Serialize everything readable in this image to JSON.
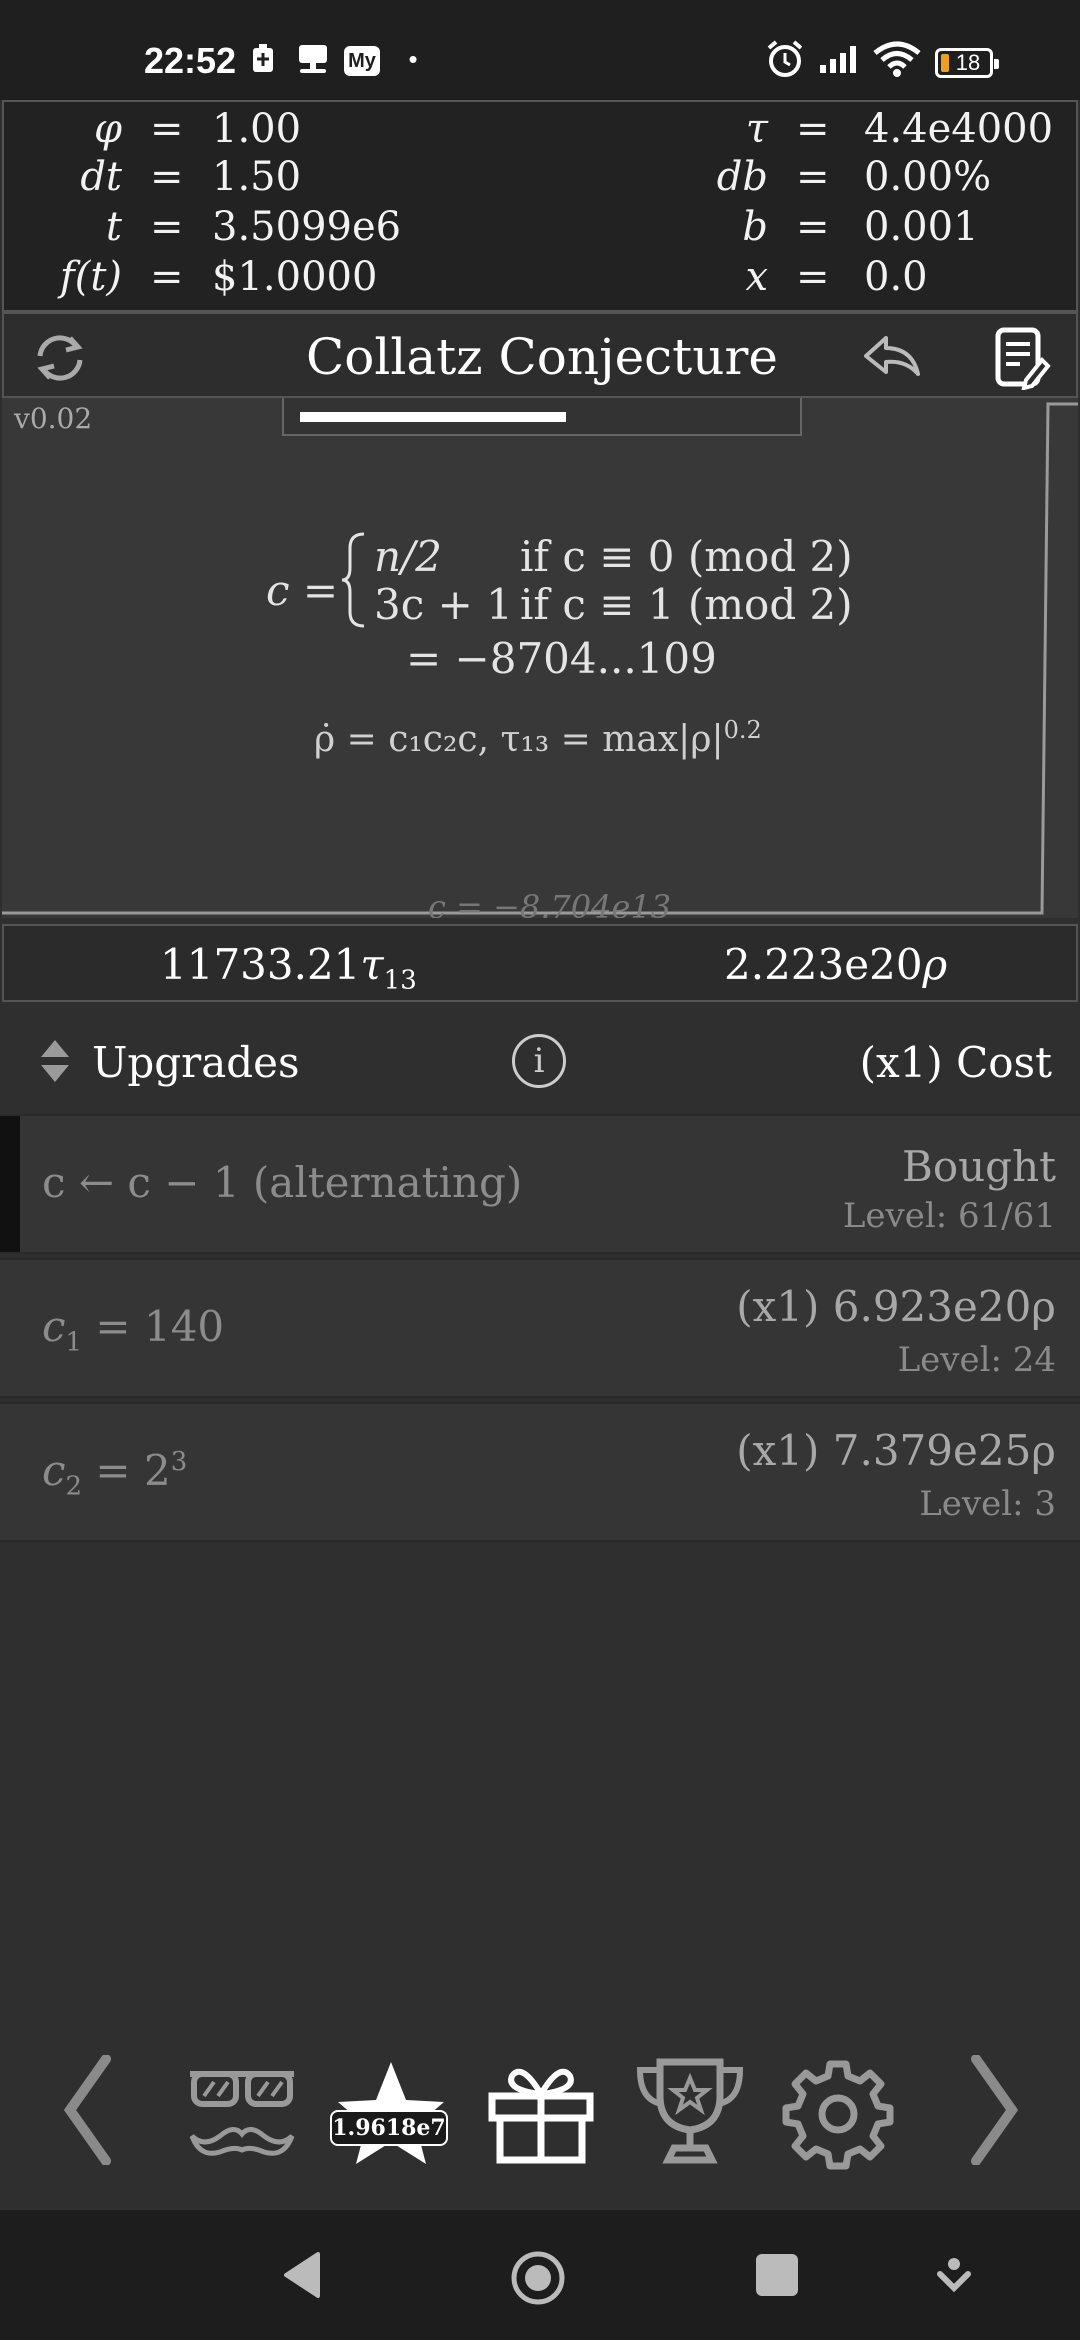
{
  "status_bar": {
    "time": "22:52",
    "my_badge": "My",
    "dot": "•",
    "battery_level": "18",
    "icons": [
      "battery-saver-icon",
      "stand-icon",
      "my-app-icon",
      "alarm-icon",
      "signal-icon",
      "wifi-icon",
      "battery-icon"
    ]
  },
  "variables": {
    "left": [
      {
        "symbol": "φ",
        "eq": "=",
        "value": "1.00"
      },
      {
        "symbol": "dt",
        "eq": "=",
        "value": "1.50"
      },
      {
        "symbol": "t",
        "eq": "=",
        "value": "3.5099e6"
      },
      {
        "symbol": "f(t)",
        "eq": "=",
        "value": "$1.0000"
      }
    ],
    "right": [
      {
        "symbol": "τ",
        "eq": "=",
        "value": "4.4e4000"
      },
      {
        "symbol": "db",
        "eq": "=",
        "value": "0.00%"
      },
      {
        "symbol": "b",
        "eq": "=",
        "value": "0.001"
      },
      {
        "symbol": "x",
        "eq": "=",
        "value": "0.0"
      }
    ]
  },
  "title_bar": {
    "title": "Collatz Conjecture"
  },
  "theory": {
    "version": "v0.02",
    "progress": 0.55,
    "formula_lhs": "c =",
    "case1_expr": "n/2",
    "case1_cond": "if c ≡ 0 (mod 2)",
    "case2_expr": "3c + 1",
    "case2_cond": "if c ≡ 1 (mod 2)",
    "formula_value": "= −8704...109",
    "rho_formula": "ρ̇ = c₁c₂c,   τ₁₃ = max|ρ|",
    "rho_exponent": "0.2",
    "graph_label": "c = −8.704e13"
  },
  "currency": {
    "tau_value": "11733.21",
    "tau_symbol": "τ",
    "tau_sub": "13",
    "rho_value": "2.223e20",
    "rho_symbol": "ρ"
  },
  "upgrades_header": {
    "label": "Upgrades",
    "info": "i",
    "cost_label": "(x1) Cost"
  },
  "upgrades": [
    {
      "name": "c ← c − 1 (alternating)",
      "status": "Bought",
      "level": "Level: 61/61"
    },
    {
      "name": "c",
      "sub": "1",
      "eq": " = 140",
      "cost": "(x1) 6.923e20ρ",
      "level": "Level: 24"
    },
    {
      "name": "c",
      "sub": "2",
      "eq": " = 2",
      "sup": "3",
      "cost": "(x1) 7.379e25ρ",
      "level": "Level: 3"
    }
  ],
  "bottom_nav": {
    "star_badge": "1.9618e7",
    "items": [
      "prev-arrow-icon",
      "disguise-icon",
      "star-icon",
      "gift-icon",
      "trophy-icon",
      "settings-gear-icon",
      "next-arrow-icon"
    ]
  },
  "colors": {
    "background": "#2f2f2f",
    "panel_dark": "#222222",
    "text": "#ececec",
    "muted": "#8c8c8c",
    "battery_accent": "#f0a020"
  }
}
